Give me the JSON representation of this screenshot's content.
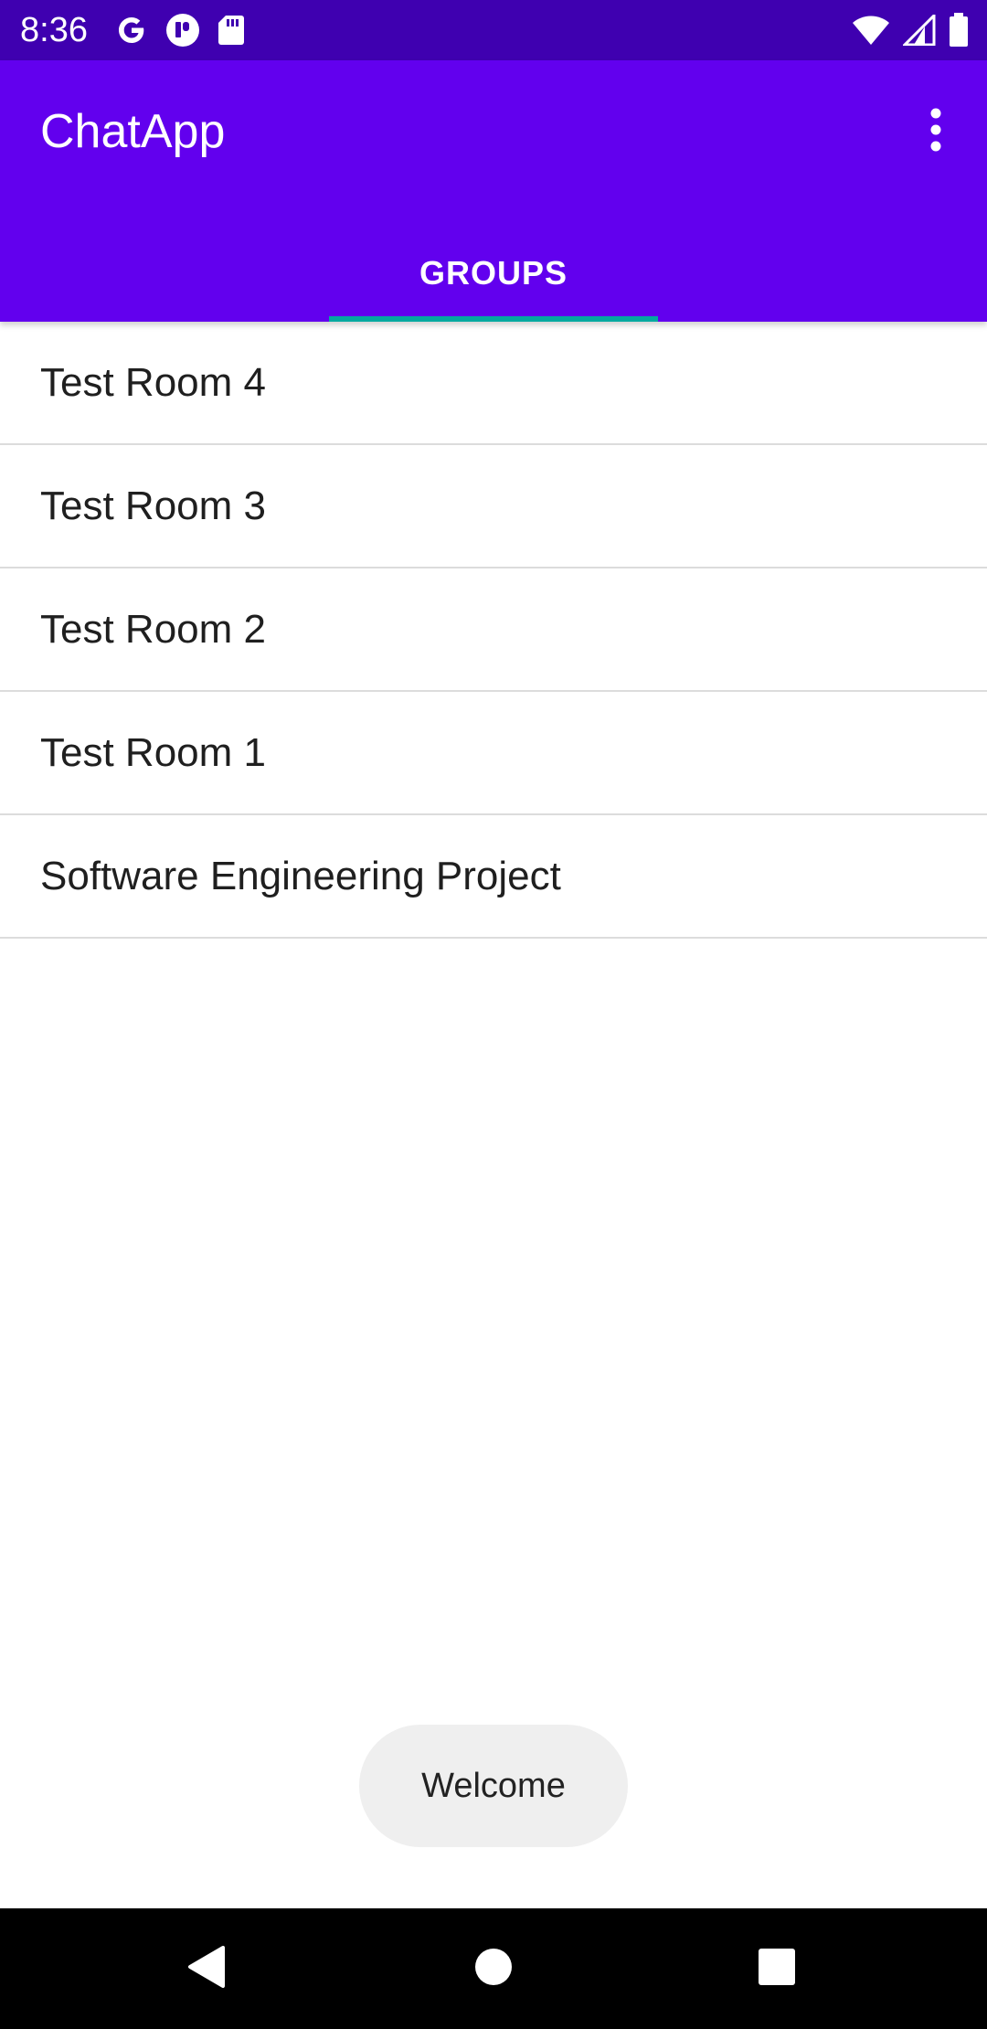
{
  "status_bar": {
    "time": "8:36",
    "left_icons": [
      "google-icon",
      "notification-app-icon",
      "sd-card-icon"
    ],
    "right_icons": [
      "wifi-icon",
      "signal-icon",
      "battery-icon"
    ]
  },
  "app_bar": {
    "title": "ChatApp",
    "overflow_icon": "more-vert-icon"
  },
  "tabs": [
    {
      "label": "GROUPS",
      "selected": true
    }
  ],
  "groups": [
    {
      "name": "Test Room 4"
    },
    {
      "name": "Test Room 3"
    },
    {
      "name": "Test Room 2"
    },
    {
      "name": "Test Room 1"
    },
    {
      "name": "Software Engineering Project"
    }
  ],
  "toast": {
    "text": "Welcome"
  },
  "nav_bar": {
    "icons": [
      "back-icon",
      "home-icon",
      "recents-icon"
    ]
  },
  "colors": {
    "status_bar": "#3f00b0",
    "app_bar": "#6200ee",
    "tab_indicator": "#03a9a0",
    "divider": "#dcdcdc",
    "toast_background": "#efefef"
  }
}
